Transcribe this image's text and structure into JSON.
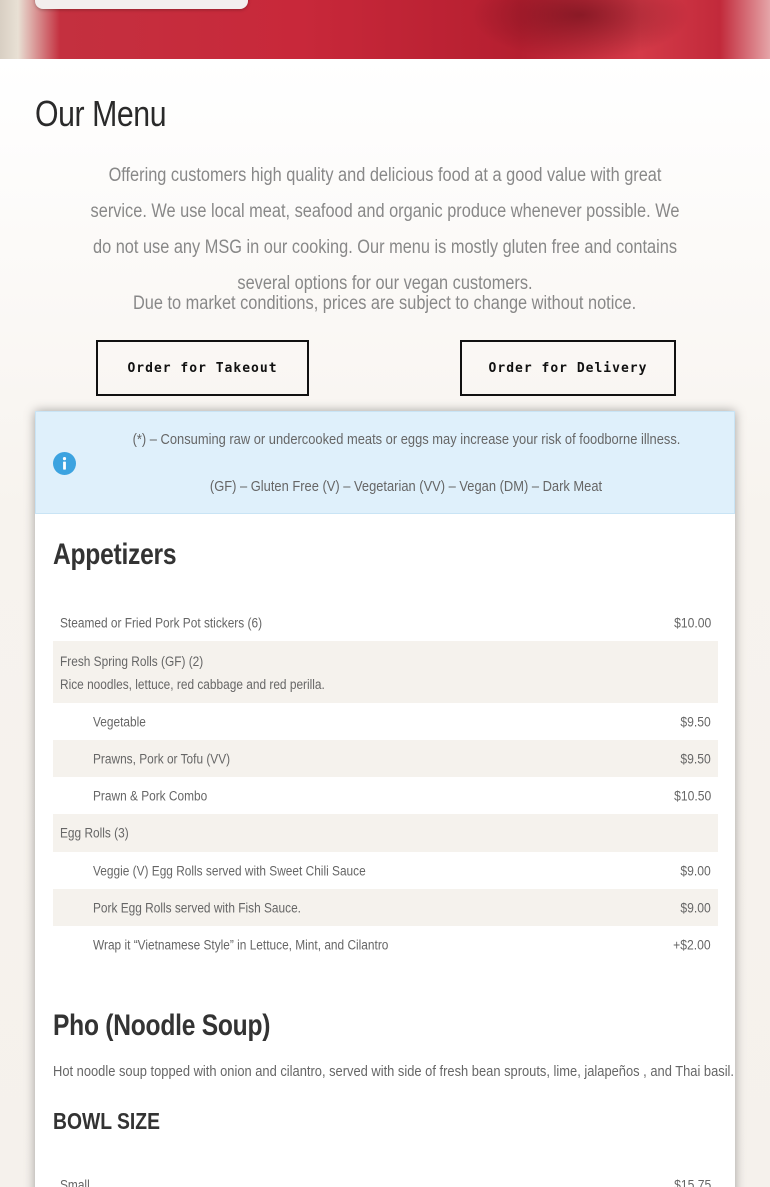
{
  "menu": {
    "title": "Our Menu",
    "intro": "Offering customers high quality and delicious food at a good value with great service. We use local meat, seafood and organic produce whenever possible. We do not use any MSG in our cooking. Our menu is mostly gluten free and contains several options for our vegan customers.",
    "notice": "Due to market conditions, prices are subject to change without notice.",
    "takeout_label": "Order for Takeout",
    "delivery_label": "Order for Delivery"
  },
  "alert": {
    "icon": "info-icon",
    "line1": "(*) – Consuming raw or undercooked meats or eggs may increase your risk of foodborne illness.",
    "line2": "(GF) – Gluten Free (V) – Vegetarian (VV) – Vegan (DM) – Dark Meat"
  },
  "appetizers": {
    "title": "Appetizers",
    "items": [
      {
        "name": "Steamed or Fried Pork Pot stickers (6)",
        "price": "$10.00"
      },
      {
        "name": "Fresh Spring Rolls (GF) (2)",
        "desc": "Rice noodles, lettuce, red cabbage and red perilla."
      },
      {
        "name": "Vegetable",
        "price": "$9.50"
      },
      {
        "name": "Prawns, Pork or Tofu (VV)",
        "price": "$9.50"
      },
      {
        "name": "Prawn & Pork Combo",
        "price": "$10.50"
      },
      {
        "name": "Egg Rolls (3)"
      },
      {
        "name": "Veggie (V) Egg Rolls served with Sweet Chili Sauce",
        "price": "$9.00"
      },
      {
        "name": "Pork Egg Rolls served with Fish Sauce.",
        "price": "$9.00"
      },
      {
        "name": "Wrap it “Vietnamese Style” in Lettuce, Mint, and Cilantro",
        "price": "+$2.00"
      }
    ]
  },
  "pho": {
    "title": "Pho (Noodle Soup)",
    "desc": "Hot noodle soup topped with onion and cilantro, served with side of fresh bean sprouts, lime, jalapeños , and Thai basil.",
    "bowl_title": "BOWL SIZE",
    "items": [
      {
        "name": "Small",
        "price": "$15.75"
      }
    ]
  }
}
